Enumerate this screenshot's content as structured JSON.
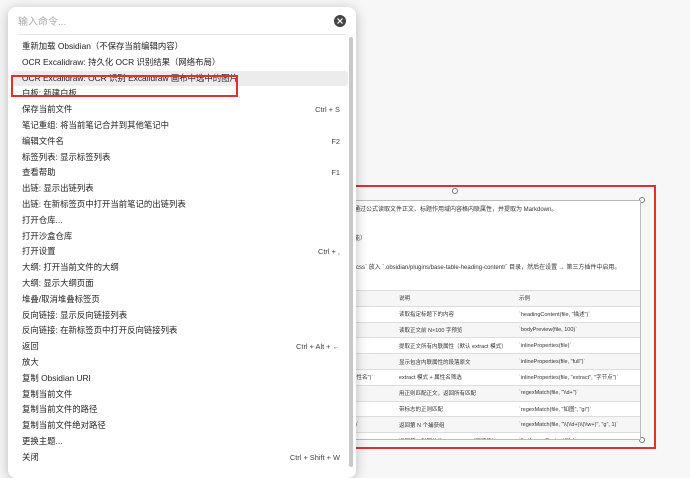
{
  "palette": {
    "placeholder": "输入命令...",
    "commands": [
      {
        "label": "重新加载 Obsidian（不保存当前编辑内容）",
        "hotkey": ""
      },
      {
        "label": "OCR Excalidraw: 持久化 OCR 识别结果（网络布局）",
        "hotkey": ""
      },
      {
        "label": "OCR Excalidraw: OCR 识别 Excalidraw 画布中选中的图片",
        "hotkey": ""
      },
      {
        "label": "白板: 新建白板",
        "hotkey": ""
      },
      {
        "label": "保存当前文件",
        "hotkey": "Ctrl + S"
      },
      {
        "label": "笔记重组: 将当前笔记合并到其他笔记中",
        "hotkey": ""
      },
      {
        "label": "编辑文件名",
        "hotkey": "F2"
      },
      {
        "label": "标签列表: 显示标签列表",
        "hotkey": ""
      },
      {
        "label": "查看帮助",
        "hotkey": "F1"
      },
      {
        "label": "出链: 显示出链列表",
        "hotkey": ""
      },
      {
        "label": "出链: 在新标签页中打开当前笔记的出链列表",
        "hotkey": ""
      },
      {
        "label": "打开仓库...",
        "hotkey": ""
      },
      {
        "label": "打开沙盒仓库",
        "hotkey": ""
      },
      {
        "label": "打开设置",
        "hotkey": "Ctrl + ,"
      },
      {
        "label": "大纲: 打开当前文件的大纲",
        "hotkey": ""
      },
      {
        "label": "大纲: 显示大纲页面",
        "hotkey": ""
      },
      {
        "label": "堆叠/取消堆叠标签页",
        "hotkey": ""
      },
      {
        "label": "反向链接: 显示反向链接列表",
        "hotkey": ""
      },
      {
        "label": "反向链接: 在新标签页中打开反向链接列表",
        "hotkey": ""
      },
      {
        "label": "返回",
        "hotkey": "Ctrl + Alt + ←"
      },
      {
        "label": "放大",
        "hotkey": ""
      },
      {
        "label": "复制 Obsidian URI",
        "hotkey": ""
      },
      {
        "label": "复制当前文件",
        "hotkey": ""
      },
      {
        "label": "复制当前文件的路径",
        "hotkey": ""
      },
      {
        "label": "复制当前文件绝对路径",
        "hotkey": ""
      },
      {
        "label": "更换主题...",
        "hotkey": ""
      },
      {
        "label": "关闭",
        "hotkey": "Ctrl + Shift + W"
      }
    ],
    "selected_index": 2
  },
  "preview": {
    "line1": "中通过公式读取文件正文、标题作用域内容格内联属性，并提取为 Markdown。",
    "line2": "功能）",
    "line3": "es.css` 放入 `.obsidian/plugins/base-table-heading-content/` 目录，然后在设置 → 第三方插件中启用。",
    "table_header": [
      "",
      "说明",
      "示例"
    ],
    "table_rows": [
      [
        "",
        "读取指定标题下的内容",
        "`headingContent(file, \"描述\")`"
      ],
      [
        "",
        "读取正文前 N×100 字预览",
        "`bodyPreview(file, 100)`"
      ],
      [
        "",
        "提取正文所有内联属性（默认 extract 模式）",
        "`inlineProperties(file)`"
      ],
      [
        "",
        "显示包含内联属性的段落原文",
        "`inlineProperties(file, \"full\")`"
      ],
      [
        "属性名\")`",
        "extract 模式 + 属性名筛选",
        "`inlineProperties(file, \"extract\", \"字节点\")`"
      ],
      [
        "",
        "用正则匹配正文，返回所有匹配",
        "`regexMatch(file, \"\\\\d+\")`"
      ],
      [
        "",
        "带标志的正则匹配",
        "`regexMatch(file, \"如图\", \"gi\")`"
      ],
      [
        "N)`",
        "返回第 N 个捕获组",
        "`regexMatch(file, \"\\\\(\\\\d+)\\\\(\\\\w+)\", \"g\", 1)`"
      ],
      [
        "",
        "返回第一张图片的 Markdown（可渲染）",
        "`firstImageContent(file)`"
      ]
    ]
  }
}
